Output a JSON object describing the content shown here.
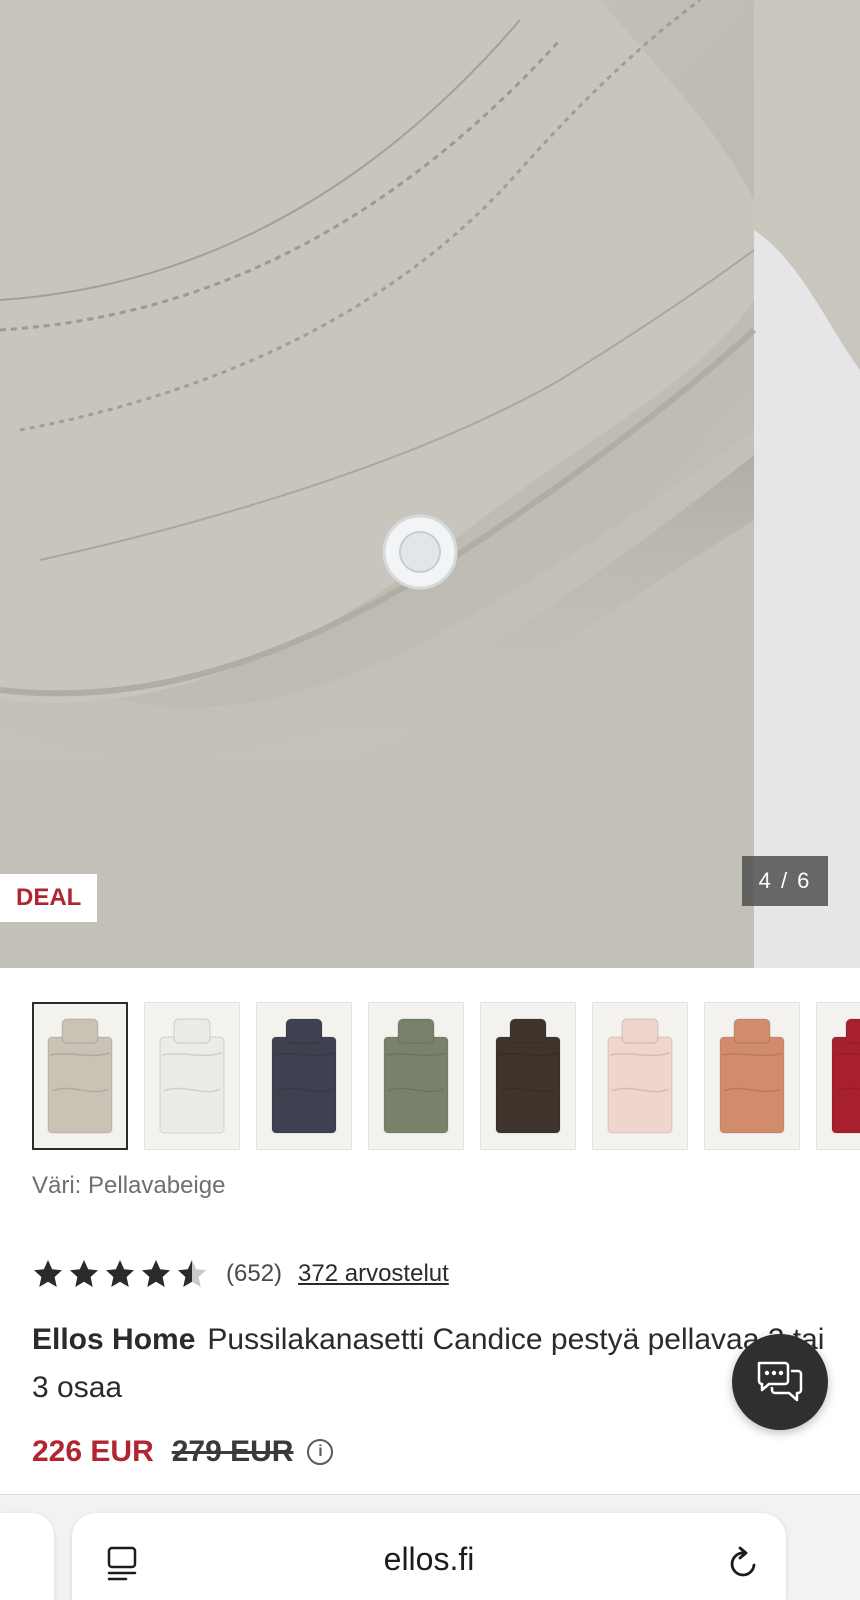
{
  "hero": {
    "badge": "DEAL",
    "counter": "4 / 6",
    "colors": {
      "fabric": "#c2bfb6",
      "stitch": "#9c998f",
      "background": "#e9e9ec",
      "snap": "#f4f6f7"
    }
  },
  "swatches": [
    {
      "name": "pellavabeige",
      "color": "#c9c2b5",
      "selected": true
    },
    {
      "name": "white",
      "color": "#ecebe8",
      "selected": false
    },
    {
      "name": "navy",
      "color": "#3e4250",
      "selected": false
    },
    {
      "name": "green",
      "color": "#78826b",
      "selected": false
    },
    {
      "name": "brown",
      "color": "#3e342c",
      "selected": false
    },
    {
      "name": "pink",
      "color": "#eed6cc",
      "selected": false
    },
    {
      "name": "terracotta",
      "color": "#d28c6c",
      "selected": false
    },
    {
      "name": "red",
      "color": "#a8202f",
      "selected": false
    }
  ],
  "color_label": "Väri: Pellavabeige",
  "rating": {
    "value": 4.5,
    "max": 5,
    "count_text": "(652)",
    "reviews_link": "372 arvostelut"
  },
  "product": {
    "brand": "Ellos Home",
    "name": "Pussilakanasetti Candice pestyä pellavaa 2 tai 3 osaa"
  },
  "price": {
    "current": "226 EUR",
    "original": "279 EUR",
    "sale_color": "#b0252f"
  },
  "chat": {
    "icon": "chat-bubble-icon"
  },
  "browser": {
    "url": "ellos.fi",
    "left_icon": "page-menu-icon",
    "right_icon": "reload-icon"
  }
}
